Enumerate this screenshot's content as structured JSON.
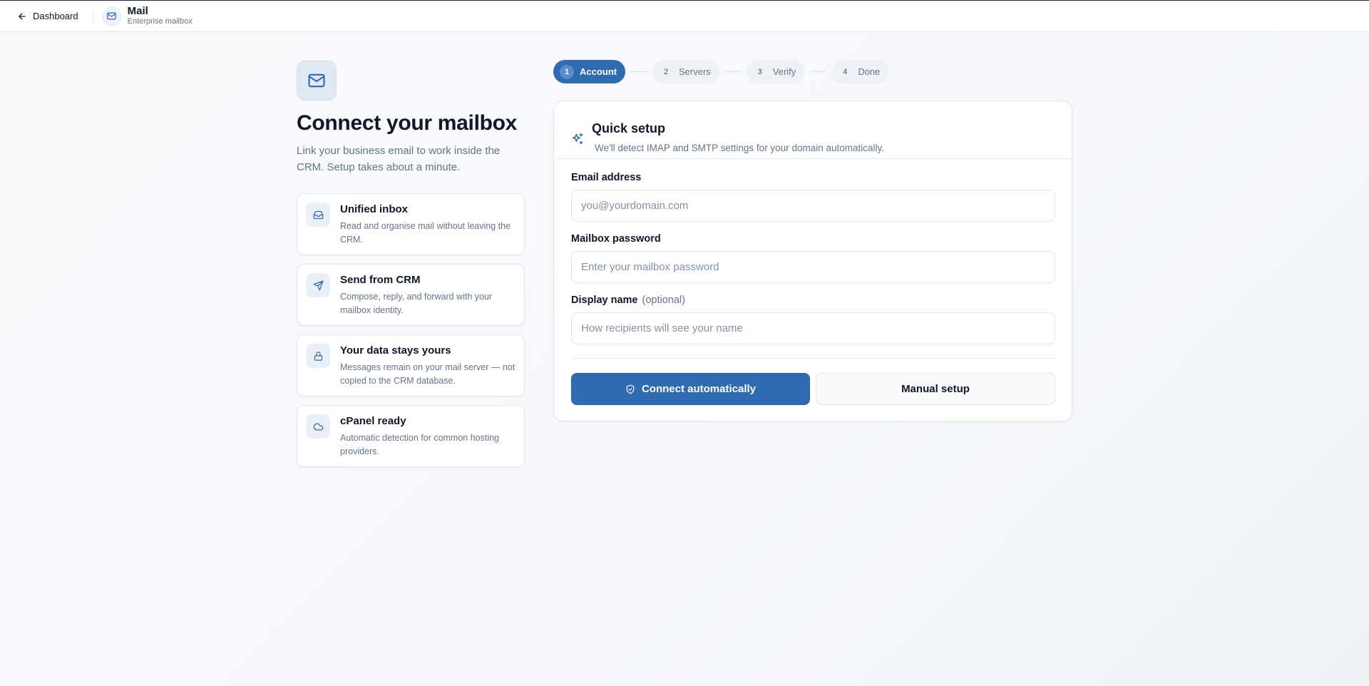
{
  "topbar": {
    "back_label": "Dashboard",
    "app_title": "Mail",
    "app_subtitle": "Enterprise mailbox"
  },
  "hero": {
    "title": "Connect your mailbox",
    "description": "Link your business email to work inside the CRM. Setup takes about a minute."
  },
  "features": [
    {
      "title": "Unified inbox",
      "description": "Read and organise mail without leaving the CRM.",
      "icon": "inbox-icon"
    },
    {
      "title": "Send from CRM",
      "description": "Compose, reply, and forward with your mailbox identity.",
      "icon": "send-icon"
    },
    {
      "title": "Your data stays yours",
      "description": "Messages remain on your mail server — not copied to the CRM database.",
      "icon": "lock-icon"
    },
    {
      "title": "cPanel ready",
      "description": "Automatic detection for common hosting providers.",
      "icon": "cloud-icon"
    }
  ],
  "stepper": {
    "steps": [
      {
        "num": "1",
        "label": "Account",
        "active": true
      },
      {
        "num": "2",
        "label": "Servers",
        "active": false
      },
      {
        "num": "3",
        "label": "Verify",
        "active": false
      },
      {
        "num": "4",
        "label": "Done",
        "active": false
      }
    ]
  },
  "setup": {
    "title": "Quick setup",
    "subtitle": "We'll detect IMAP and SMTP settings for your domain automatically.",
    "email_label": "Email address",
    "email_placeholder": "you@yourdomain.com",
    "email_value": "",
    "password_label": "Mailbox password",
    "password_placeholder": "Enter your mailbox password",
    "password_value": "",
    "name_label": "Display name",
    "name_optional": "(optional)",
    "name_placeholder": "How recipients will see your name",
    "name_value": "",
    "connect_label": "Connect automatically",
    "manual_label": "Manual setup"
  },
  "colors": {
    "accent": "#2e6bb0",
    "text": "#0f172a",
    "muted": "#64748b"
  }
}
